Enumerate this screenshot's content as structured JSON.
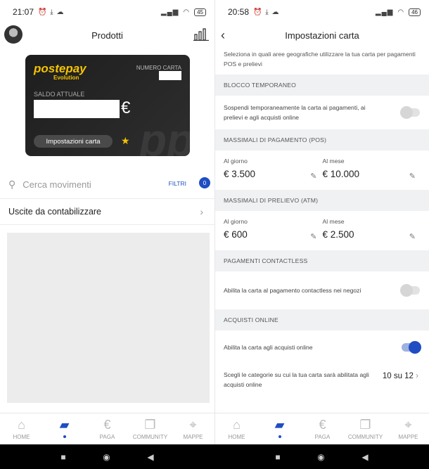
{
  "left": {
    "status": {
      "time": "21:07",
      "battery": "45"
    },
    "header": {
      "title": "Prodotti"
    },
    "card": {
      "brand": "postepay",
      "brand_sub": "Evolution",
      "number_label": "NUMERO CARTA",
      "number_masked": "****",
      "balance_label": "SALDO ATTUALE",
      "currency": "€",
      "settings_button": "Impostazioni carta",
      "watermark": "pp"
    },
    "search": {
      "placeholder": "Cerca movimenti",
      "filters_label": "FILTRI",
      "filters_count": "0"
    },
    "pending": {
      "label": "Uscite da contabilizzare"
    }
  },
  "right": {
    "status": {
      "time": "20:58",
      "battery": "46"
    },
    "header": {
      "title": "Impostazioni carta"
    },
    "geo_desc": "Seleziona in quali aree geografiche utilizzare la tua carta per pagamenti POS e prelievi",
    "blocco": {
      "header": "BLOCCO TEMPORANEO",
      "text": "Sospendi temporaneamente la carta ai pagamenti, ai prelievi e agli acquisti online",
      "enabled": false
    },
    "pos": {
      "header": "MASSIMALI DI PAGAMENTO (POS)",
      "daily_label": "Al giorno",
      "daily_value": "€ 3.500",
      "monthly_label": "Al mese",
      "monthly_value": "€ 10.000"
    },
    "atm": {
      "header": "MASSIMALI DI PRELIEVO (ATM)",
      "daily_label": "Al giorno",
      "daily_value": "€ 600",
      "monthly_label": "Al mese",
      "monthly_value": "€ 2.500"
    },
    "contactless": {
      "header": "PAGAMENTI CONTACTLESS",
      "text": "Abilita la carta al pagamento contactless nei negozi",
      "enabled": false
    },
    "online": {
      "header": "ACQUISTI ONLINE",
      "text": "Abilita la carta agli acquisti online",
      "enabled": true,
      "categories_text": "Scegli le categorie su cui la tua carta sarà abilitata agli acquisti online",
      "categories_count": "10 su 12"
    }
  },
  "nav": {
    "items": [
      {
        "label": "HOME",
        "icon": "home-icon"
      },
      {
        "label": "",
        "icon": "wallet-icon",
        "active": true
      },
      {
        "label": "PAGA",
        "icon": "euro-icon"
      },
      {
        "label": "COMMUNITY",
        "icon": "community-icon"
      },
      {
        "label": "MAPPE",
        "icon": "map-pin-icon"
      }
    ]
  },
  "colors": {
    "accent": "#1f4ec2",
    "card_brand": "#f5c400",
    "section_bg": "#f0f1f3"
  }
}
